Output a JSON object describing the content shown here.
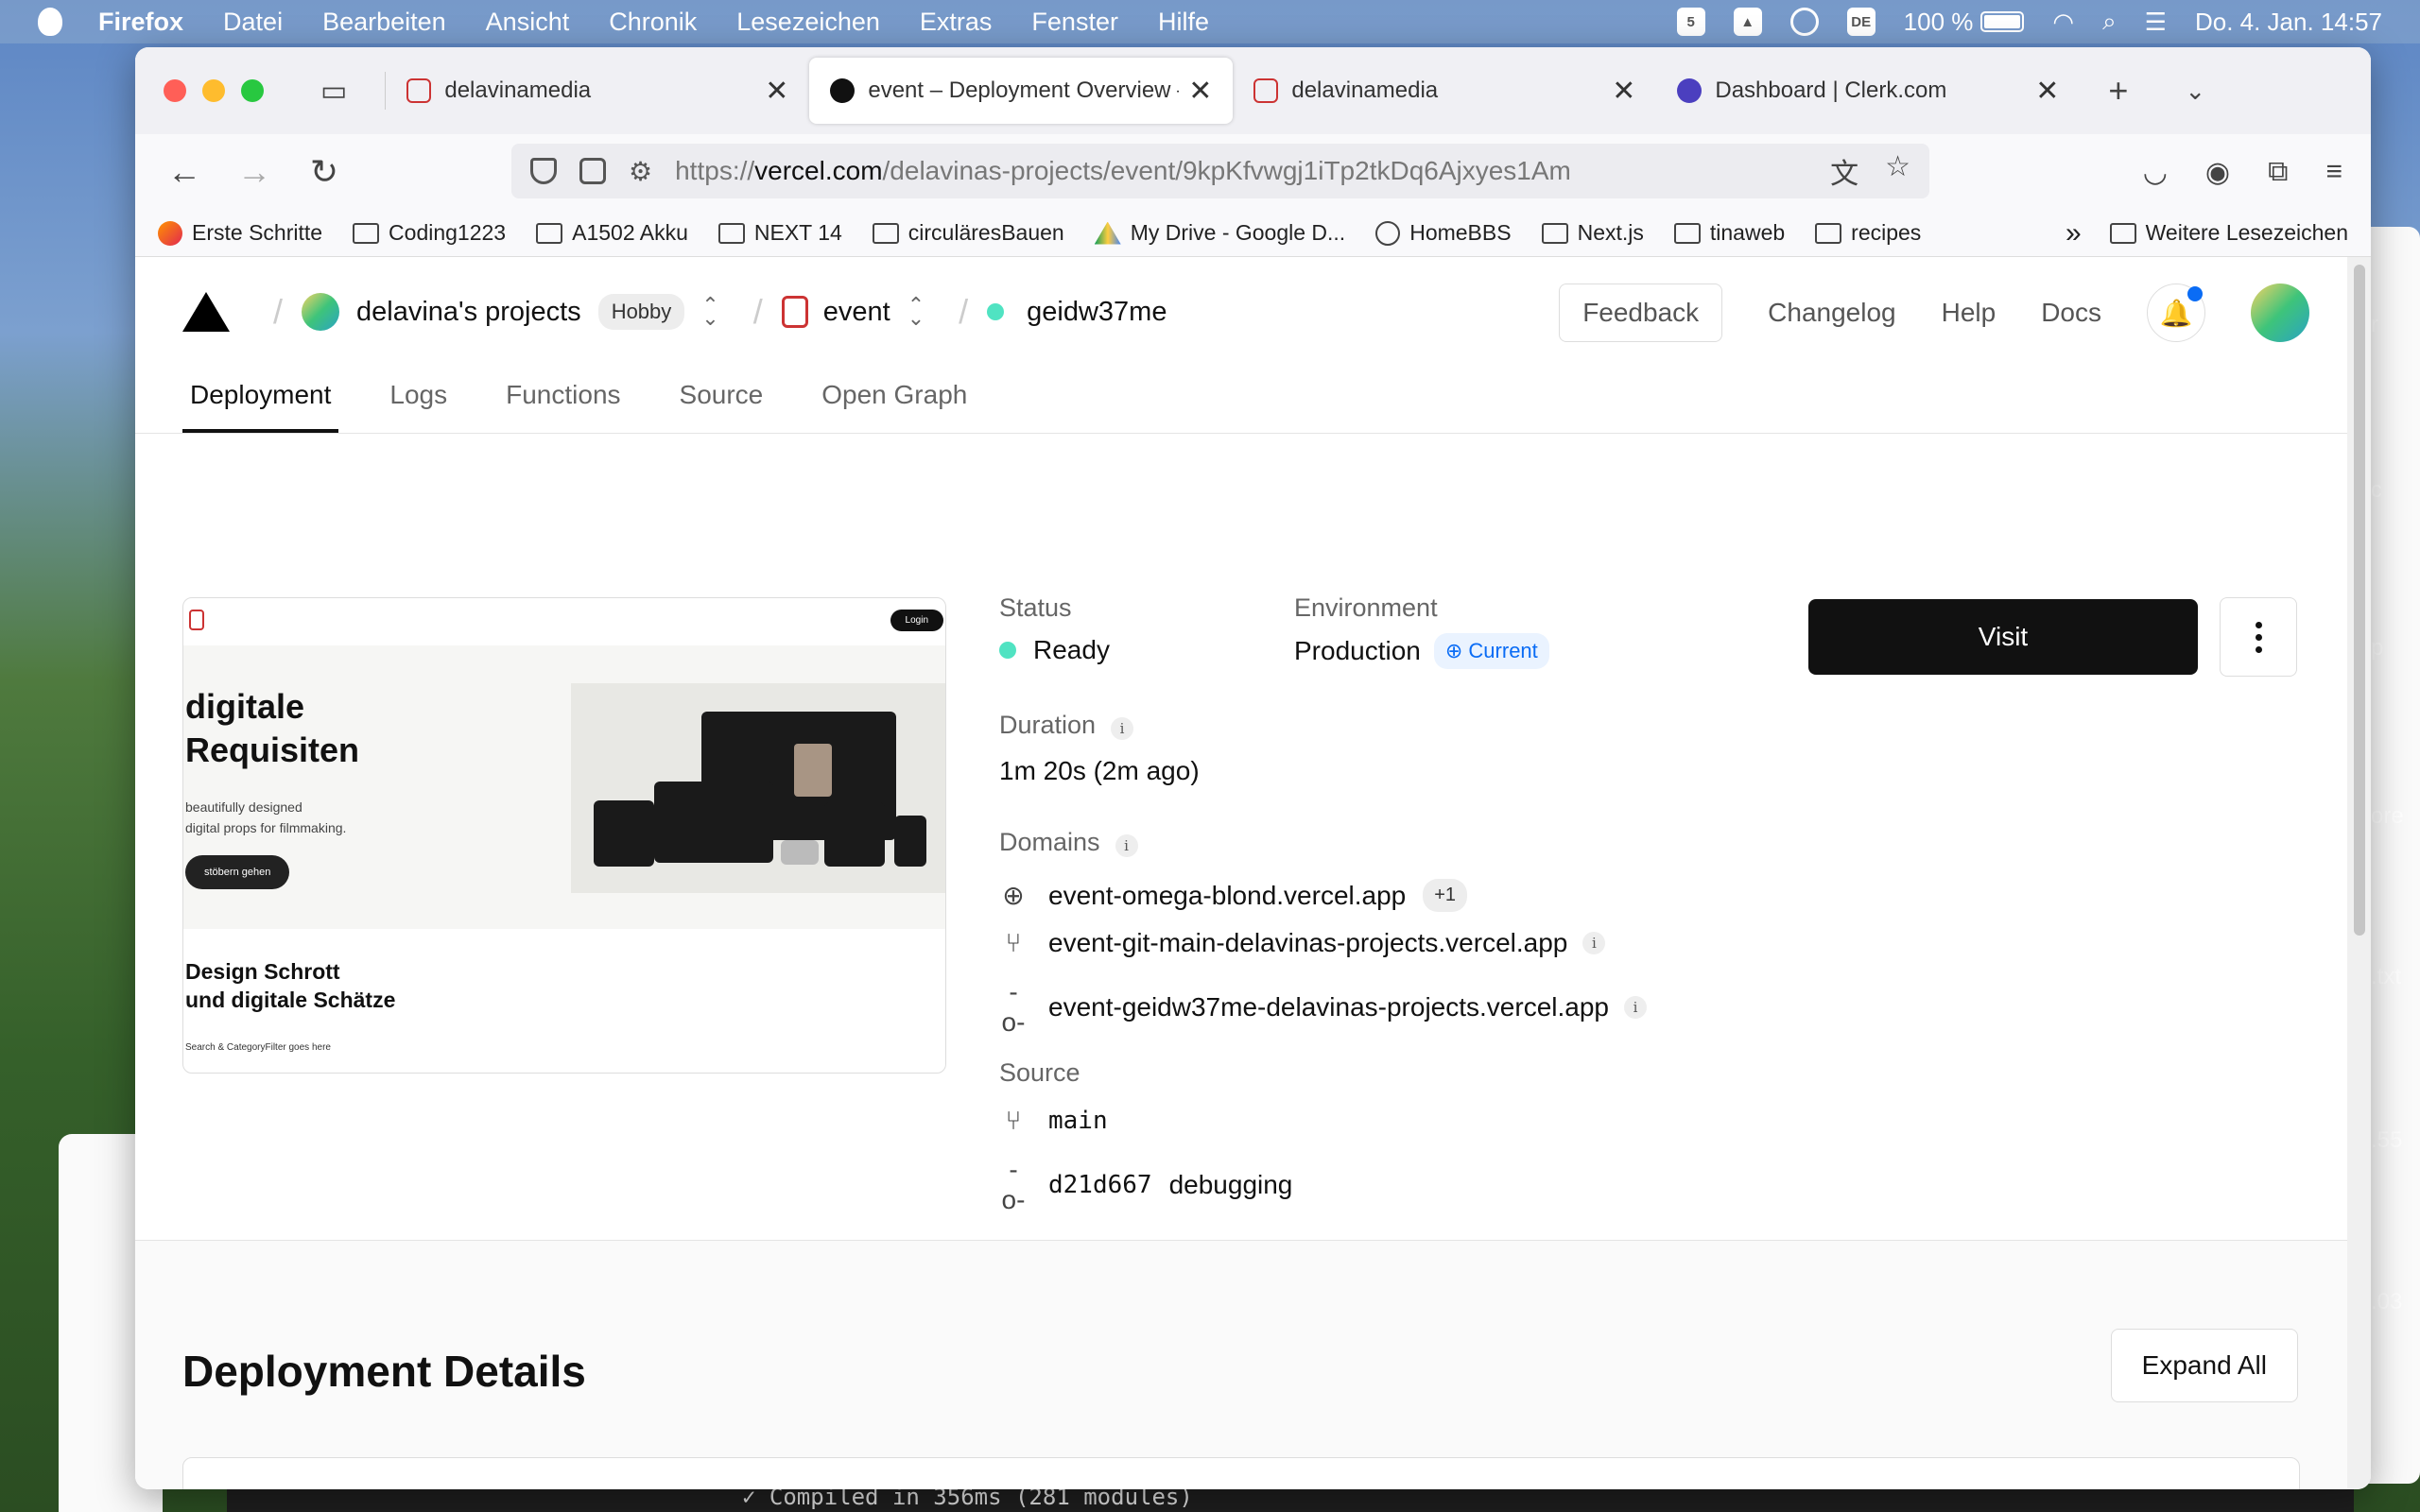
{
  "menubar": {
    "app": "Firefox",
    "items": [
      "Datei",
      "Bearbeiten",
      "Ansicht",
      "Chronik",
      "Lesezeichen",
      "Extras",
      "Fenster",
      "Hilfe"
    ],
    "lang": "DE",
    "battery": "100 %",
    "datetime": "Do. 4. Jan.  14:57"
  },
  "tabs": [
    {
      "title": "delavinamedia"
    },
    {
      "title": "event – Deployment Overview –"
    },
    {
      "title": "delavinamedia"
    },
    {
      "title": "Dashboard | Clerk.com"
    }
  ],
  "url": {
    "prefix": "https://",
    "domain": "vercel.com",
    "path": "/delavinas-projects/event/9kpKfvwgj1iTp2tkDq6Ajxyes1Am"
  },
  "bookmarks": {
    "items": [
      "Erste Schritte",
      "Coding1223",
      "A1502 Akku",
      "NEXT 14",
      "circuläresBauen",
      "My Drive - Google D...",
      "HomeBBS",
      "Next.js",
      "tinaweb",
      "recipes"
    ],
    "more": "Weitere Lesezeichen"
  },
  "header": {
    "team": "delavina's projects",
    "plan": "Hobby",
    "project": "event",
    "deployment": "geidw37me",
    "feedback": "Feedback",
    "changelog": "Changelog",
    "help": "Help",
    "docs": "Docs"
  },
  "subnav": [
    "Deployment",
    "Logs",
    "Functions",
    "Source",
    "Open Graph"
  ],
  "preview": {
    "login": "Login",
    "h1_line1": "digitale",
    "h1_line2": "Requisiten",
    "sub_line1": "beautifully designed",
    "sub_line2": "digital props for filmmaking.",
    "button": "stöbern gehen",
    "h2_line1": "Design Schrott",
    "h2_line2": "und digitale Schätze",
    "footer": "Search & CategoryFilter goes here"
  },
  "deployment": {
    "status_label": "Status",
    "status": "Ready",
    "environment_label": "Environment",
    "environment": "Production",
    "current": "Current",
    "duration_label": "Duration",
    "duration": "1m 20s (2m ago)",
    "domains_label": "Domains",
    "domains": [
      "event-omega-blond.vercel.app",
      "event-git-main-delavinas-projects.vercel.app",
      "event-geidw37me-delavinas-projects.vercel.app"
    ],
    "domains_more": "+1",
    "source_label": "Source",
    "branch": "main",
    "commit": "d21d667",
    "commit_msg": "debugging",
    "visit": "Visit"
  },
  "details": {
    "title": "Deployment Details",
    "expand": "Expand All"
  },
  "terminal": {
    "line": "✓ Compiled in 356ms (281 modules)"
  },
  "background_fragments": [
    "r",
    "c",
    "p",
    "ore",
    ".txt",
    ".55",
    ".03"
  ]
}
